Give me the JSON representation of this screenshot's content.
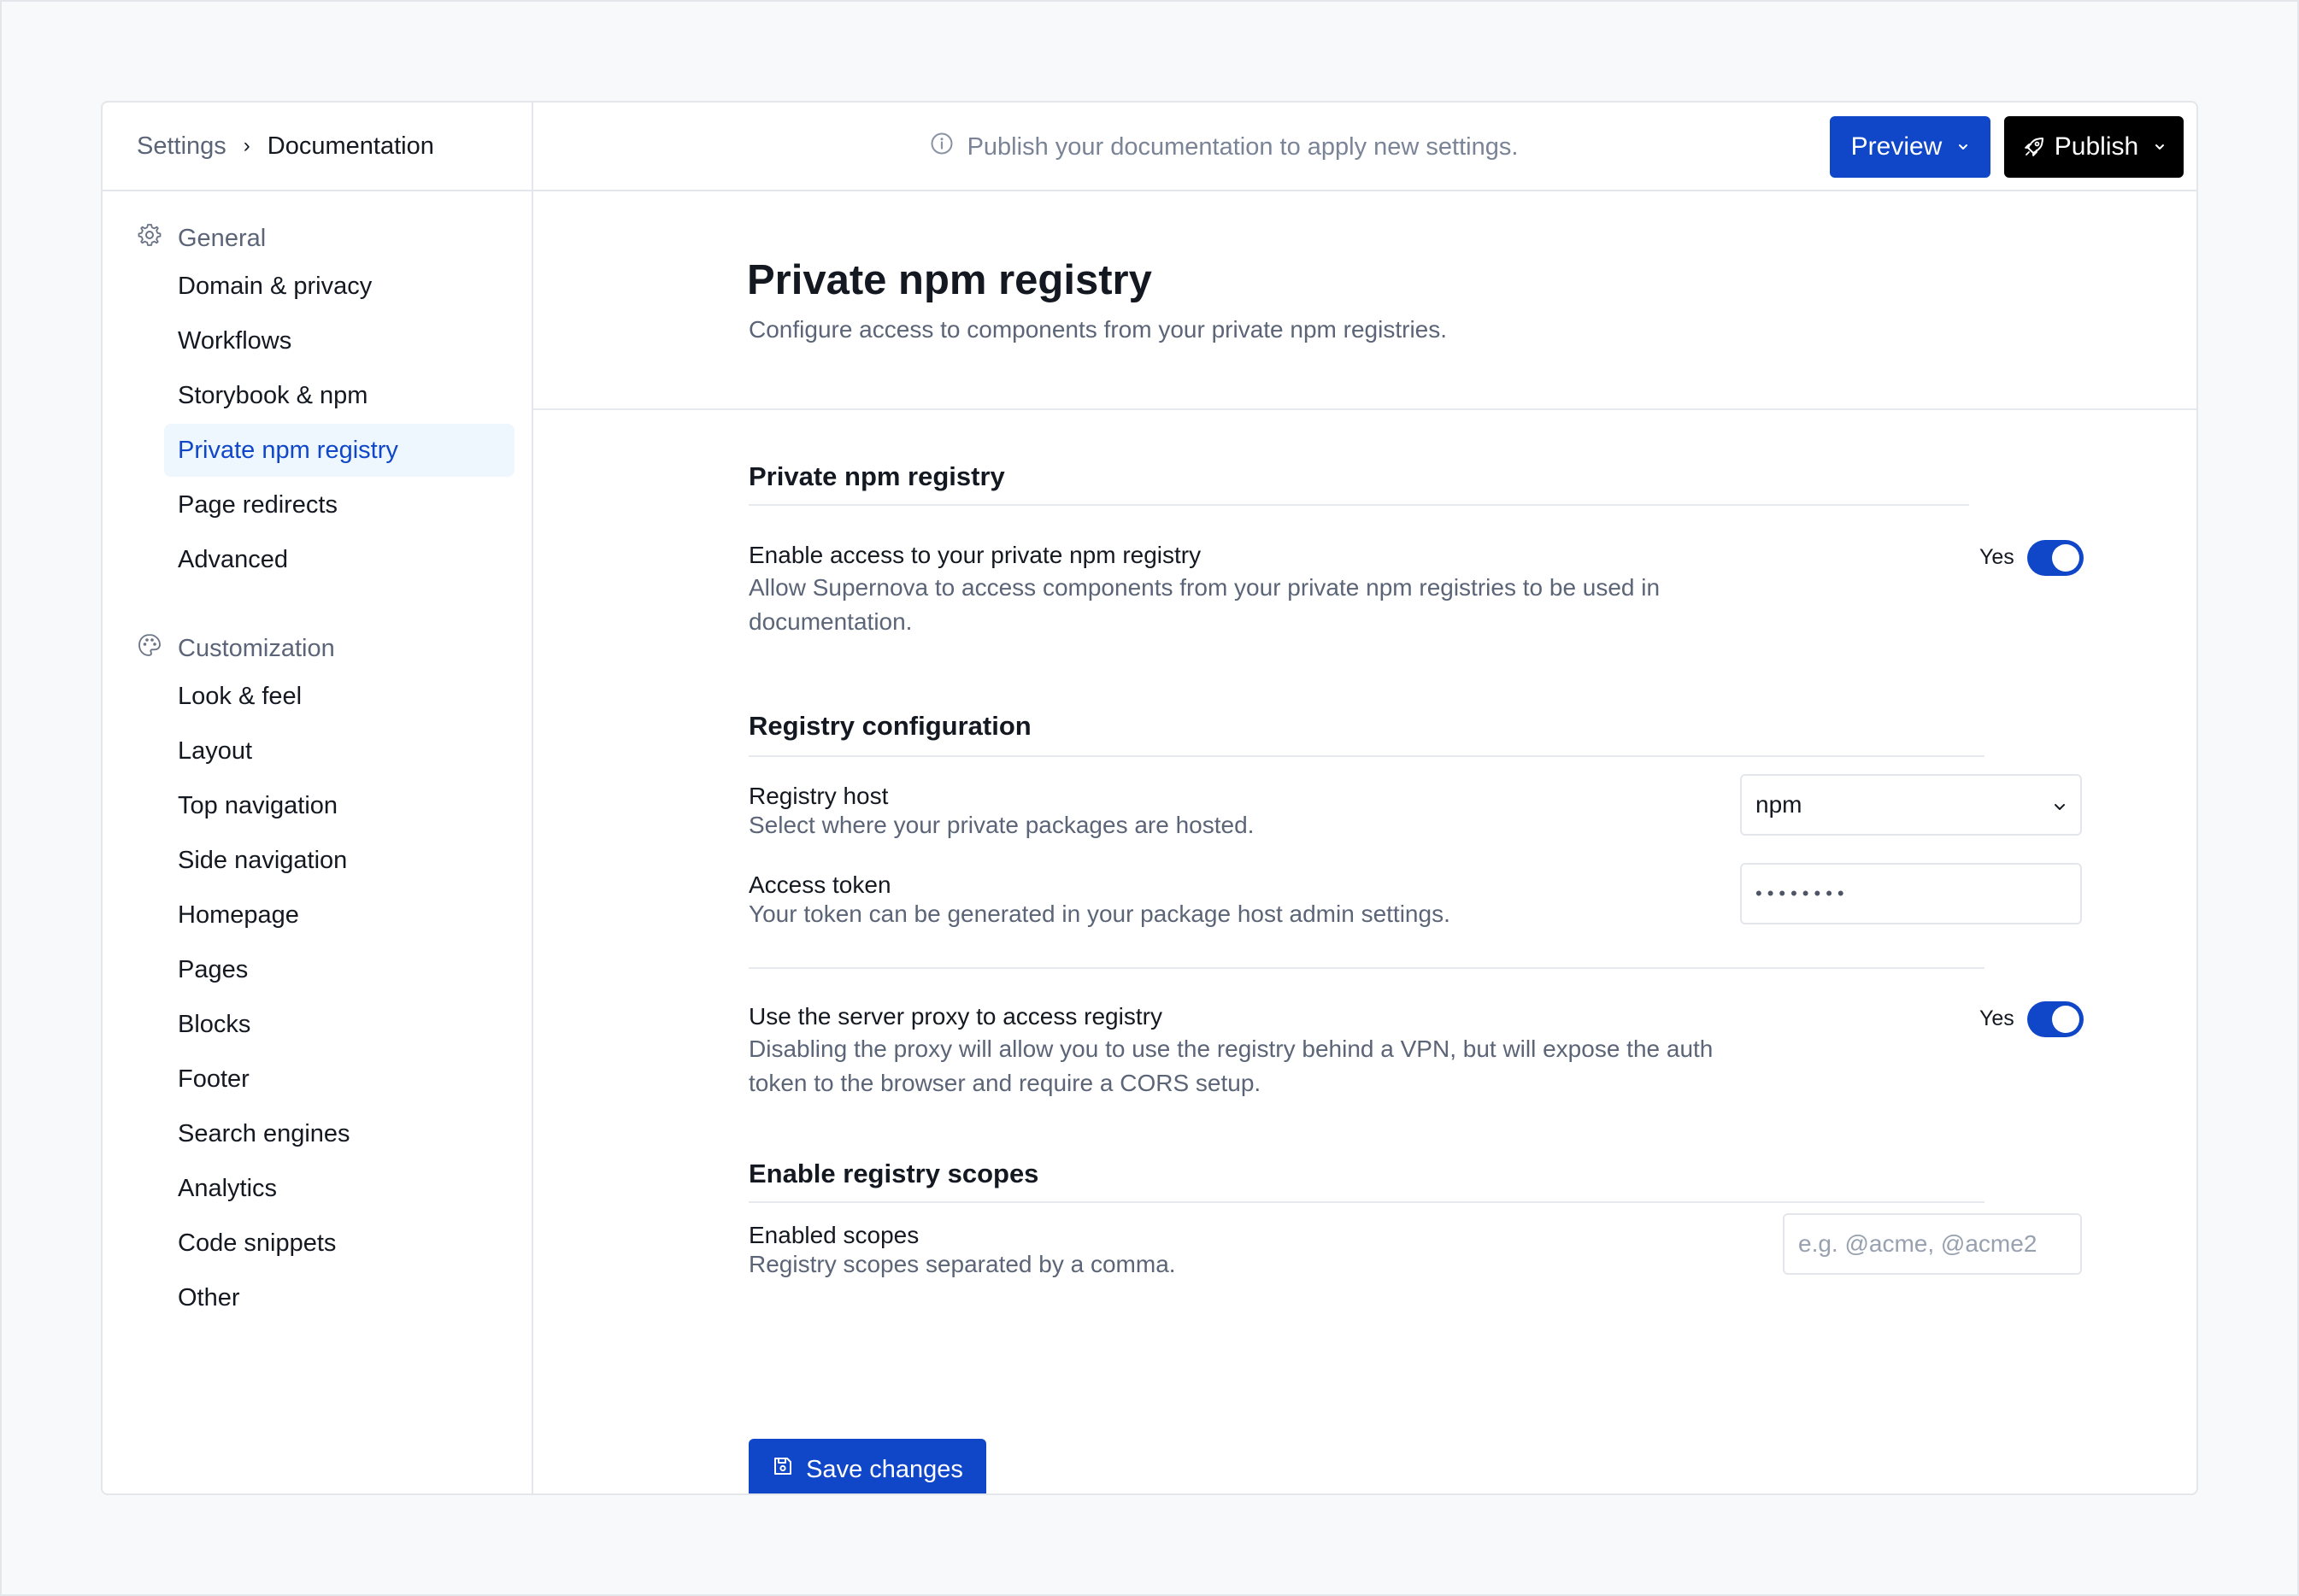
{
  "breadcrumb": {
    "parent": "Settings",
    "separator": "›",
    "current": "Documentation"
  },
  "topbar": {
    "notice": "Publish your documentation to apply new settings.",
    "preview_label": "Preview",
    "publish_label": "Publish"
  },
  "sidebar": {
    "general": {
      "label": "General",
      "items": [
        "Domain & privacy",
        "Workflows",
        "Storybook & npm",
        "Private npm registry",
        "Page redirects",
        "Advanced"
      ]
    },
    "customization": {
      "label": "Customization",
      "items": [
        "Look & feel",
        "Layout",
        "Top navigation",
        "Side navigation",
        "Homepage",
        "Pages",
        "Blocks",
        "Footer",
        "Search engines",
        "Analytics",
        "Code snippets",
        "Other"
      ]
    },
    "active_item": "Private npm registry"
  },
  "page": {
    "title": "Private npm registry",
    "subtitle": "Configure access to components from your private npm registries."
  },
  "section_registry": {
    "title": "Private npm registry",
    "enable_label": "Enable access to your private npm registry",
    "enable_desc_line1": "Allow Supernova to access components from your private npm registries to be used in",
    "enable_desc_line2": "documentation.",
    "enable_value": "Yes"
  },
  "section_config": {
    "title": "Registry configuration",
    "host_label": "Registry host",
    "host_desc": "Select where your private packages are hosted.",
    "host_value": "npm",
    "token_label": "Access token",
    "token_desc": "Your token can be generated in your package host admin settings.",
    "token_value": "••••••••",
    "proxy_label": "Use the server proxy to access registry",
    "proxy_desc_line1": "Disabling the proxy will allow you to use the registry behind a VPN, but will expose the auth",
    "proxy_desc_line2": "token to the browser and require a CORS setup.",
    "proxy_value": "Yes"
  },
  "section_scopes": {
    "title": "Enable registry scopes",
    "scopes_label": "Enabled scopes",
    "scopes_desc": "Registry scopes separated by a comma.",
    "scopes_placeholder": "e.g. @acme, @acme2",
    "scopes_value": ""
  },
  "save_label": "Save changes",
  "colors": {
    "accent": "#1047c9",
    "active_bg": "#eef6fe",
    "muted": "#5b6577",
    "border": "#e3e6eb"
  }
}
